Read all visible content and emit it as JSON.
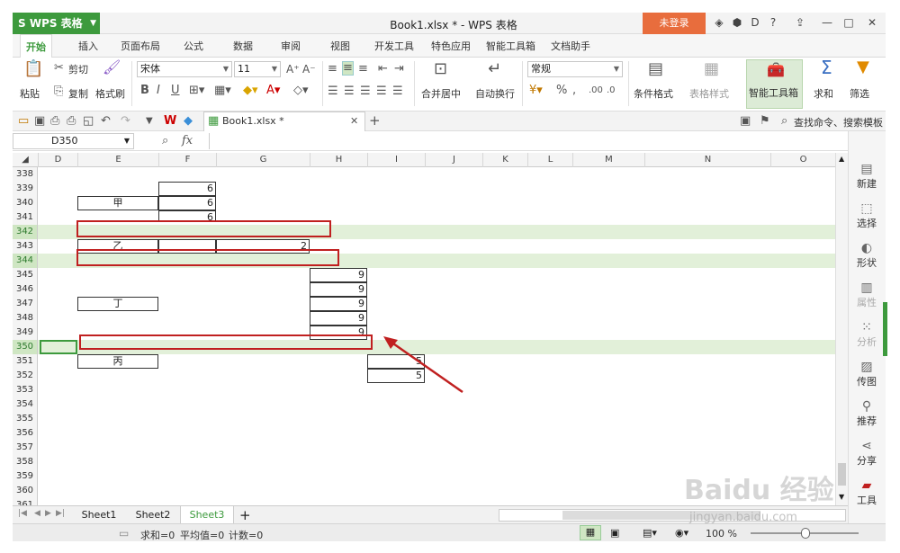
{
  "titlebar": {
    "app_name": "WPS 表格",
    "title": "Book1.xlsx * - WPS 表格",
    "login": "未登录"
  },
  "tabs": [
    "开始",
    "插入",
    "页面布局",
    "公式",
    "数据",
    "审阅",
    "视图",
    "开发工具",
    "特色应用",
    "智能工具箱",
    "文档助手"
  ],
  "ribbon": {
    "paste": "粘贴",
    "cut": "剪切",
    "copy": "复制",
    "format_painter": "格式刷",
    "font": "宋体",
    "size": "11",
    "number_format": "常规",
    "merge": "合并居中",
    "wrap": "自动换行",
    "conditional": "条件格式",
    "table_style": "表格样式",
    "smart_tools": "智能工具箱",
    "sum": "求和",
    "filter": "筛选",
    "bold": "B",
    "italic": "I",
    "underline": "U",
    "percent": "%"
  },
  "quickbar": {
    "doc_tab": "Book1.xlsx *",
    "search": "查找命令、搜索模板"
  },
  "formula": {
    "name_box": "D350",
    "fx": "fx"
  },
  "columns": [
    "D",
    "E",
    "F",
    "G",
    "H",
    "I",
    "J",
    "K",
    "L",
    "M",
    "N",
    "O"
  ],
  "rows": [
    "338",
    "339",
    "340",
    "341",
    "342",
    "343",
    "344",
    "345",
    "346",
    "347",
    "348",
    "349",
    "350",
    "351",
    "352",
    "353",
    "354",
    "355",
    "356",
    "357",
    "358",
    "359",
    "360",
    "361"
  ],
  "cells": {
    "e340": "甲",
    "f339": "6",
    "f340": "6",
    "f341": "6",
    "e343": "乙",
    "g343": "2",
    "h345": "9",
    "h346": "9",
    "h347": "9",
    "h348": "9",
    "h349": "9",
    "e347": "丁",
    "e351": "丙",
    "i351": "5",
    "i352": "5"
  },
  "sidepanel": [
    "新建",
    "选择",
    "形状",
    "属性",
    "分析",
    "传图",
    "推荐",
    "分享",
    "工具"
  ],
  "sheets": [
    "Sheet1",
    "Sheet2",
    "Sheet3"
  ],
  "status": {
    "sum": "求和=0",
    "avg": "平均值=0",
    "count": "计数=0",
    "zoom": "100 %"
  },
  "watermark": {
    "brand": "Baidu 经验",
    "url": "jingyan.baidu.com"
  },
  "colors": {
    "accent": "#3d9a3d",
    "highlight_row": "#e2f0d9",
    "annotation": "#c02020",
    "login": "#e86d3d"
  }
}
